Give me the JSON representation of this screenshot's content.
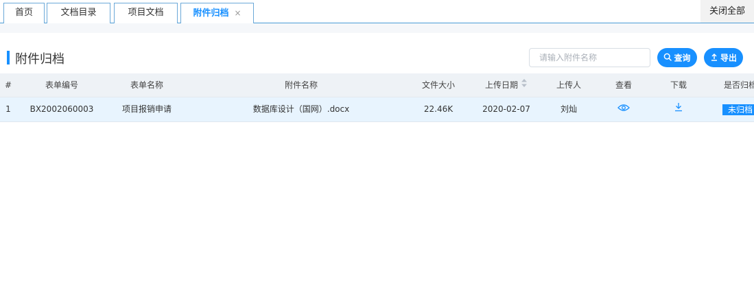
{
  "tabs": {
    "home": "首页",
    "catalog": "文档目录",
    "project_docs": "项目文档",
    "attachment_archive": "附件归档",
    "close_symbol": "×",
    "close_all": "关闭全部"
  },
  "panel": {
    "title": "附件归档",
    "search_placeholder": "请输入附件名称",
    "query_label": "查询",
    "export_label": "导出"
  },
  "table": {
    "headers": {
      "index": "#",
      "form_no": "表单编号",
      "form_name": "表单名称",
      "attachment_name": "附件名称",
      "file_size": "文件大小",
      "upload_date": "上传日期",
      "uploader": "上传人",
      "view": "查看",
      "download": "下载",
      "archived": "是否归档"
    },
    "rows": [
      {
        "index": "1",
        "form_no": "BX2002060003",
        "form_name": "项目报销申请",
        "attachment_name": "数据库设计（国网）.docx",
        "file_size": "22.46K",
        "upload_date": "2020-02-07",
        "uploader": "刘灿",
        "view_icon": "eye-icon",
        "download_icon": "download-icon",
        "archived": "未归档"
      }
    ]
  },
  "colors": {
    "accent": "#1890ff",
    "header_bg": "#eef2f6",
    "row_highlight": "#e8f4fe"
  }
}
